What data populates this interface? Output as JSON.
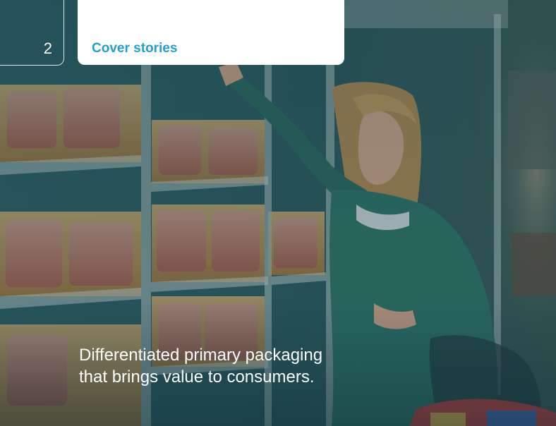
{
  "page": {
    "number": "2"
  },
  "section": {
    "label": "Cover stories"
  },
  "headline": {
    "line1": "Differentiated primary packaging",
    "line2": "that brings value to consumers."
  },
  "photo": {
    "description_icon": "supermarket-photo",
    "tint": "#1d4b55",
    "accent": "#1f9fd6"
  }
}
